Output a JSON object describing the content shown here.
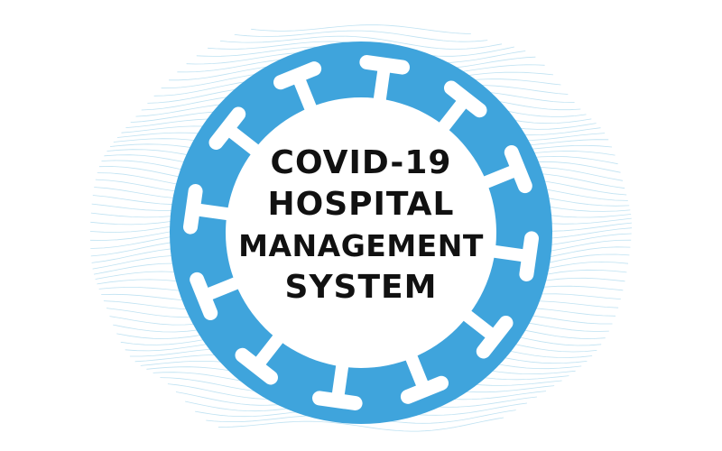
{
  "logo": {
    "title_lines": [
      "COVID-19",
      "HOSPITAL",
      "MANAGEMENT",
      "SYSTEM"
    ],
    "icon": "virus-icon"
  },
  "colors": {
    "virus_ring": "#3fa4dc",
    "virus_inner": "#ffffff",
    "background_waves": "#a9d8ee",
    "text": "#111111",
    "page_background": "#ffffff"
  }
}
